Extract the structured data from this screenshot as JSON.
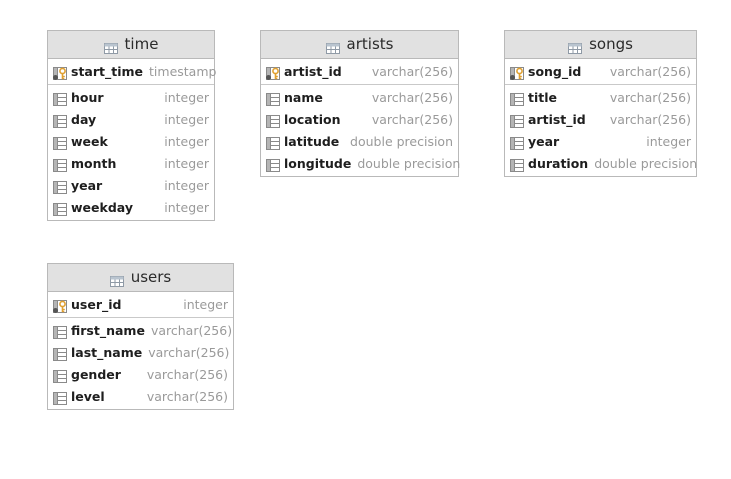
{
  "tables": [
    {
      "id": "time",
      "title": "time",
      "pk": [
        {
          "name": "start_time",
          "type": "timestamp",
          "icon": "primary-key-column-icon"
        }
      ],
      "columns": [
        {
          "name": "hour",
          "type": "integer",
          "icon": "column-icon"
        },
        {
          "name": "day",
          "type": "integer",
          "icon": "column-icon"
        },
        {
          "name": "week",
          "type": "integer",
          "icon": "column-icon"
        },
        {
          "name": "month",
          "type": "integer",
          "icon": "column-icon"
        },
        {
          "name": "year",
          "type": "integer",
          "icon": "column-icon"
        },
        {
          "name": "weekday",
          "type": "integer",
          "icon": "column-icon"
        }
      ]
    },
    {
      "id": "artists",
      "title": "artists",
      "pk": [
        {
          "name": "artist_id",
          "type": "varchar(256)",
          "icon": "primary-key-column-icon"
        }
      ],
      "columns": [
        {
          "name": "name",
          "type": "varchar(256)",
          "icon": "column-icon"
        },
        {
          "name": "location",
          "type": "varchar(256)",
          "icon": "column-icon"
        },
        {
          "name": "latitude",
          "type": "double precision",
          "icon": "column-icon"
        },
        {
          "name": "longitude",
          "type": "double precision",
          "icon": "column-icon"
        }
      ]
    },
    {
      "id": "songs",
      "title": "songs",
      "pk": [
        {
          "name": "song_id",
          "type": "varchar(256)",
          "icon": "primary-key-column-icon"
        }
      ],
      "columns": [
        {
          "name": "title",
          "type": "varchar(256)",
          "icon": "column-icon"
        },
        {
          "name": "artist_id",
          "type": "varchar(256)",
          "icon": "column-icon"
        },
        {
          "name": "year",
          "type": "integer",
          "icon": "column-icon"
        },
        {
          "name": "duration",
          "type": "double precision",
          "icon": "column-icon"
        }
      ]
    },
    {
      "id": "users",
      "title": "users",
      "pk": [
        {
          "name": "user_id",
          "type": "integer",
          "icon": "primary-key-column-icon"
        }
      ],
      "columns": [
        {
          "name": "first_name",
          "type": "varchar(256)",
          "icon": "column-icon"
        },
        {
          "name": "last_name",
          "type": "varchar(256)",
          "icon": "column-icon"
        },
        {
          "name": "gender",
          "type": "varchar(256)",
          "icon": "column-icon"
        },
        {
          "name": "level",
          "type": "varchar(256)",
          "icon": "column-icon"
        }
      ]
    }
  ],
  "colors": {
    "header_bg": "#e1e1e1",
    "border": "#b9b9b9",
    "key_icon": "#e0a030",
    "column_icon": "#8a8a8a",
    "type_text": "#9a9a9a"
  }
}
